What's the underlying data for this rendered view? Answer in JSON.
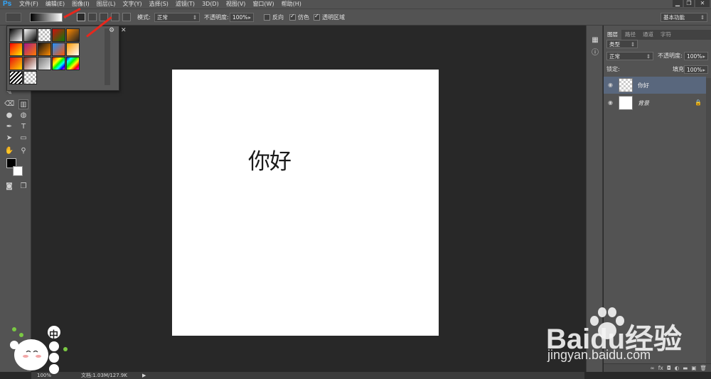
{
  "app": {
    "logo": "Ps"
  },
  "menu": [
    "文件(F)",
    "编辑(E)",
    "图像(I)",
    "图层(L)",
    "文字(Y)",
    "选择(S)",
    "滤镜(T)",
    "3D(D)",
    "视图(V)",
    "窗口(W)",
    "帮助(H)"
  ],
  "window_controls": {
    "minimize": "▁",
    "restore": "❐",
    "close": "✕"
  },
  "options_bar": {
    "mode_label": "模式:",
    "mode_value": "正常",
    "opacity_label": "不透明度:",
    "opacity_value": "100%",
    "reverse_label": "反向",
    "dither_label": "仿色",
    "transparency_label": "透明区域",
    "workspace": "基本功能"
  },
  "gradient_swatches": [
    [
      "#000000",
      "#ffffff"
    ],
    [
      "#ffffff",
      "#000000"
    ],
    [
      "checker",
      "#000"
    ],
    [
      "#d01010",
      "#0a7a0a"
    ],
    [
      "#ff8a00",
      "#222"
    ],
    [
      "#ff0000",
      "#ffee00"
    ],
    [
      "#a21a8a",
      "#ff7a00"
    ],
    [
      "#111",
      "#ff8c00"
    ],
    [
      "#1e90ff",
      "#ff5500"
    ],
    [
      "#ff9900",
      "#ffffff"
    ],
    [
      "#e60f0f",
      "#ffd400"
    ],
    [
      "#7a2a1a",
      "#ffffff"
    ],
    [
      "#777",
      "#eee"
    ],
    [
      "rainbow",
      ""
    ],
    [
      "rainbow2",
      ""
    ],
    [
      "stripes",
      ""
    ],
    [
      "checker2",
      ""
    ]
  ],
  "canvas_text": "你好",
  "layers_panel": {
    "tabs": [
      "图层",
      "路径",
      "通道",
      "字符"
    ],
    "filter_kind": "类型",
    "blend_mode": "正常",
    "opacity_label": "不透明度:",
    "opacity_value": "100%",
    "lock_label": "锁定:",
    "fill_label": "填充:",
    "fill_value": "100%",
    "layers": [
      {
        "name": "你好",
        "selected": true,
        "transparent": true
      },
      {
        "name": "背景",
        "selected": false,
        "locked": true
      }
    ]
  },
  "status": {
    "zoom": "100%",
    "doc_info": "文档:1.03M/127.9K"
  },
  "watermark": {
    "logo": "Baidu经验",
    "url": "jingyan.baidu.com"
  },
  "colors": {
    "panel_bg": "#535353",
    "canvas_bg": "#282828",
    "layer_selected": "#59677d",
    "annotation": "#e8271c"
  }
}
